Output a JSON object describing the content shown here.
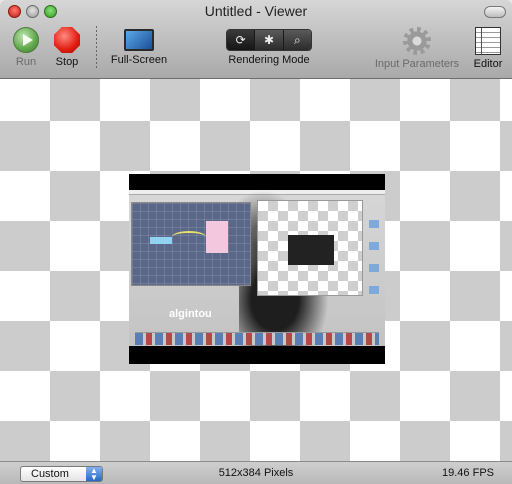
{
  "window": {
    "title": "Untitled - Viewer"
  },
  "toolbar": {
    "run_label": "Run",
    "stop_label": "Stop",
    "fullscreen_label": "Full-Screen",
    "rendering_mode_label": "Rendering Mode",
    "rendering_modes": [
      {
        "icon": "refresh-icon",
        "glyph": "⟳",
        "selected": true
      },
      {
        "icon": "bug-icon",
        "glyph": "✱",
        "selected": false
      },
      {
        "icon": "magnifier-icon",
        "glyph": "⌕",
        "selected": false
      }
    ],
    "input_parameters_label": "Input Parameters",
    "editor_label": "Editor"
  },
  "status": {
    "size_preset": "Custom",
    "resolution": "512x384 Pixels",
    "fps": "19.46 FPS"
  },
  "preview": {
    "logo_text": "algintou"
  }
}
